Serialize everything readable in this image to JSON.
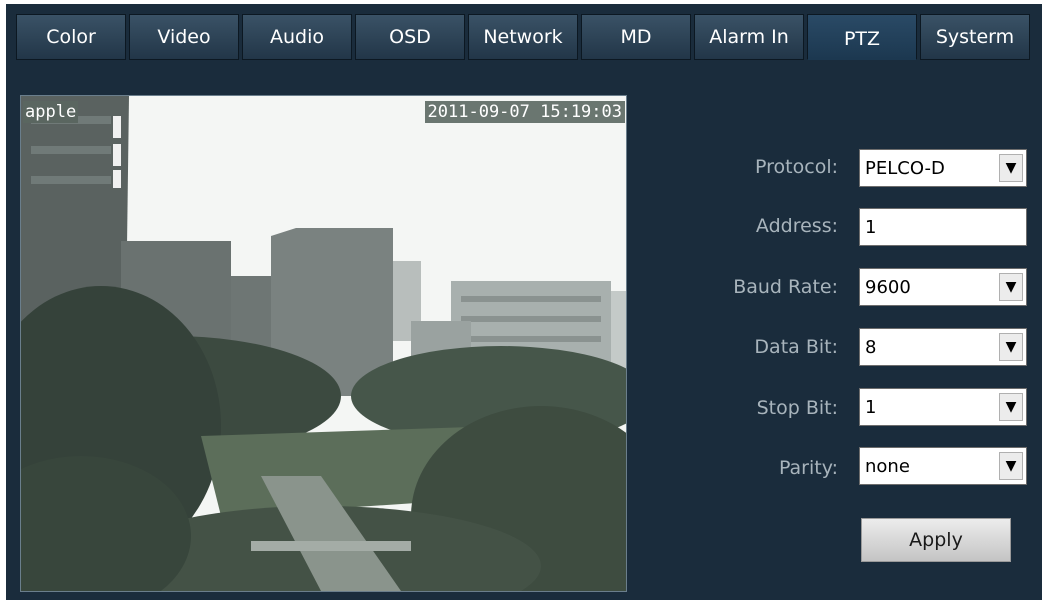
{
  "tabs": [
    "Color",
    "Video",
    "Audio",
    "OSD",
    "Network",
    "MD",
    "Alarm In",
    "PTZ",
    "Systerm"
  ],
  "active_tab": "PTZ",
  "video": {
    "osd_name": "apple",
    "osd_time": "2011-09-07 15:19:03"
  },
  "ptz": {
    "protocol": {
      "label": "Protocol:",
      "value": "PELCO-D"
    },
    "address": {
      "label": "Address:",
      "value": "1"
    },
    "baud_rate": {
      "label": "Baud Rate:",
      "value": "9600"
    },
    "data_bit": {
      "label": "Data Bit:",
      "value": "8"
    },
    "stop_bit": {
      "label": "Stop Bit:",
      "value": "1"
    },
    "parity": {
      "label": "Parity:",
      "value": "none"
    },
    "apply_label": "Apply"
  },
  "colors": {
    "panel_bg": "#1a2c3c",
    "label_text": "#a8b4bc"
  }
}
